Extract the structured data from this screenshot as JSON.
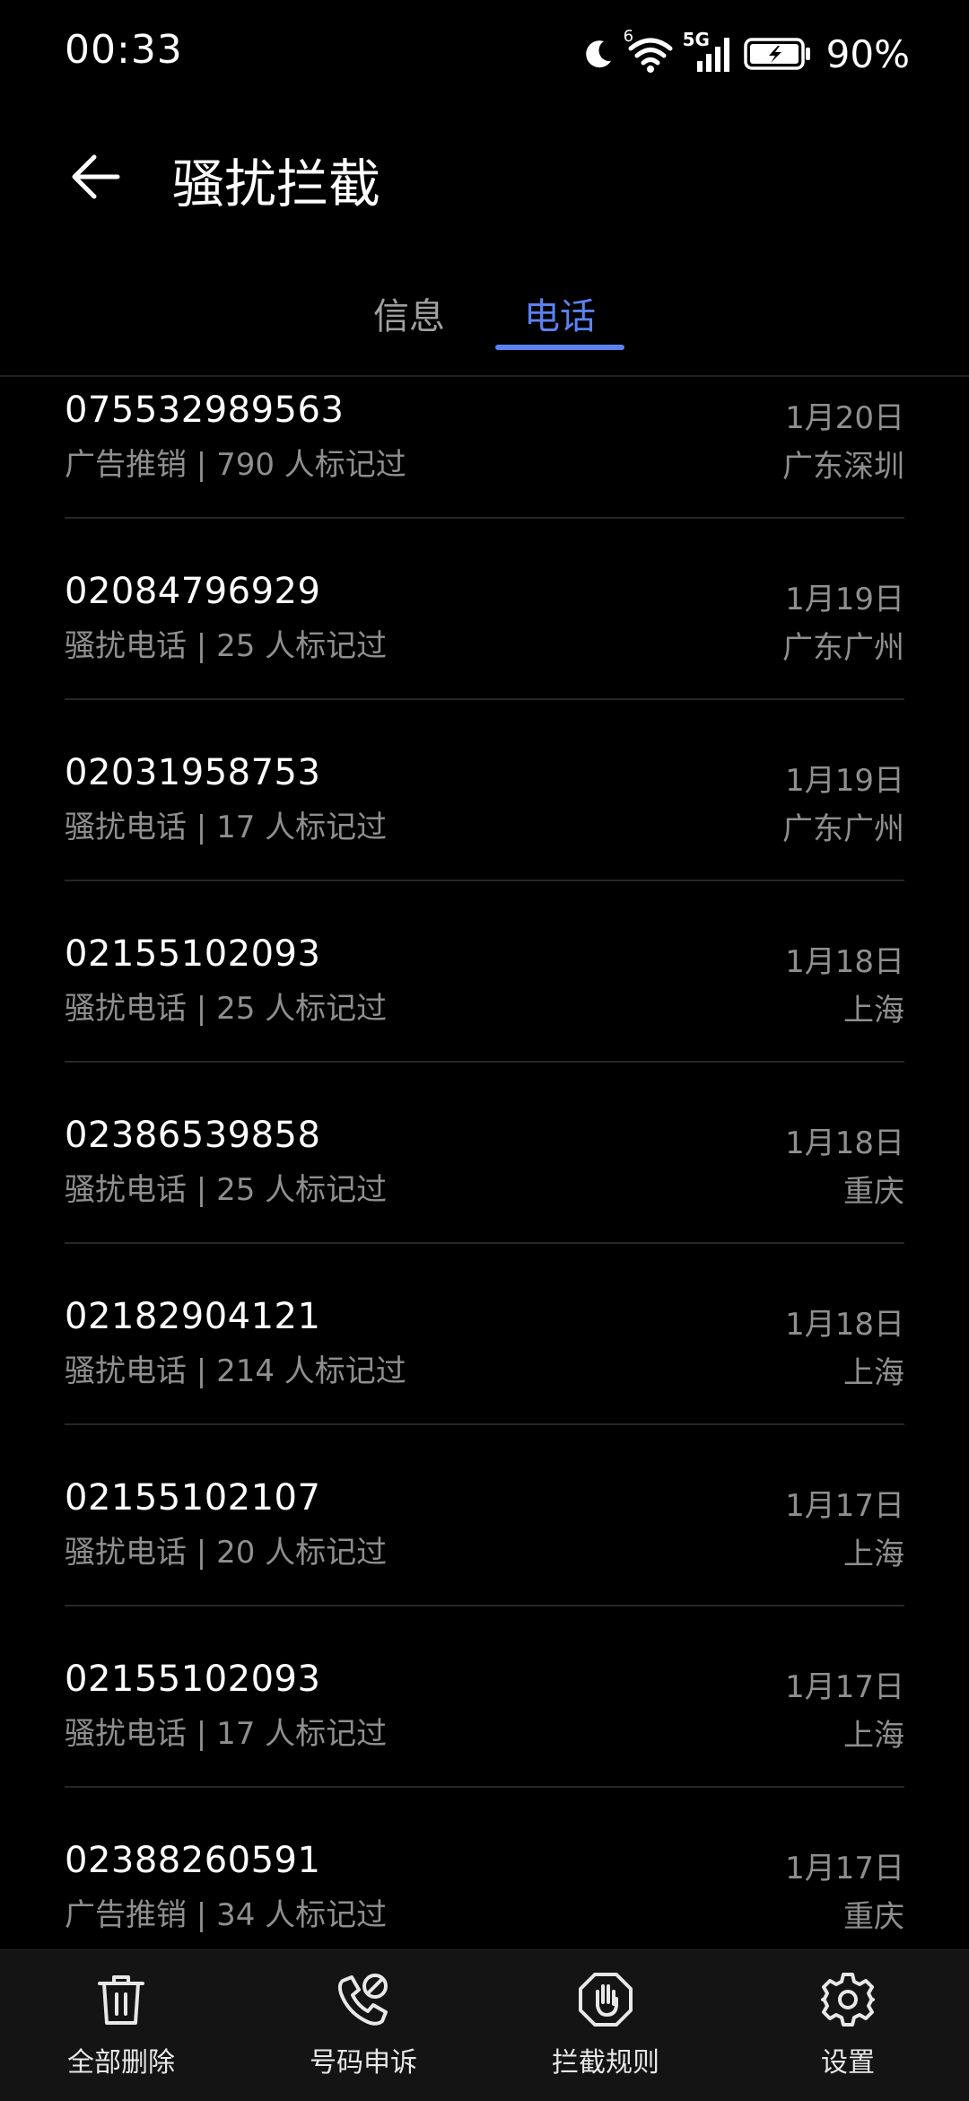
{
  "status_bar": {
    "time": "00:33",
    "battery": "90%",
    "network": "5G",
    "wifi_badge": "6",
    "icons": [
      "moon-icon",
      "wifi-icon",
      "signal-icon",
      "battery-charging-icon"
    ]
  },
  "header": {
    "title": "骚扰拦截"
  },
  "tabs": [
    {
      "label": "信息",
      "active": false
    },
    {
      "label": "电话",
      "active": true
    }
  ],
  "accent_color": "#5b82f0",
  "calls": [
    {
      "number": "075532989563",
      "type": "广告推销",
      "count_text": "790 人标记过",
      "date": "1月20日",
      "location": "广东深圳"
    },
    {
      "number": "02084796929",
      "type": "骚扰电话",
      "count_text": "25 人标记过",
      "date": "1月19日",
      "location": "广东广州"
    },
    {
      "number": "02031958753",
      "type": "骚扰电话",
      "count_text": "17 人标记过",
      "date": "1月19日",
      "location": "广东广州"
    },
    {
      "number": "02155102093",
      "type": "骚扰电话",
      "count_text": "25 人标记过",
      "date": "1月18日",
      "location": "上海"
    },
    {
      "number": "02386539858",
      "type": "骚扰电话",
      "count_text": "25 人标记过",
      "date": "1月18日",
      "location": "重庆"
    },
    {
      "number": "02182904121",
      "type": "骚扰电话",
      "count_text": "214 人标记过",
      "date": "1月18日",
      "location": "上海"
    },
    {
      "number": "02155102107",
      "type": "骚扰电话",
      "count_text": "20 人标记过",
      "date": "1月17日",
      "location": "上海"
    },
    {
      "number": "02155102093",
      "type": "骚扰电话",
      "count_text": "17 人标记过",
      "date": "1月17日",
      "location": "上海"
    },
    {
      "number": "02388260591",
      "type": "广告推销",
      "count_text": "34 人标记过",
      "date": "1月17日",
      "location": "重庆"
    }
  ],
  "bottom_actions": [
    {
      "label": "全部删除",
      "icon": "trash-icon"
    },
    {
      "label": "号码申诉",
      "icon": "phone-appeal-icon"
    },
    {
      "label": "拦截规则",
      "icon": "hand-stop-icon"
    },
    {
      "label": "设置",
      "icon": "gear-icon"
    }
  ]
}
